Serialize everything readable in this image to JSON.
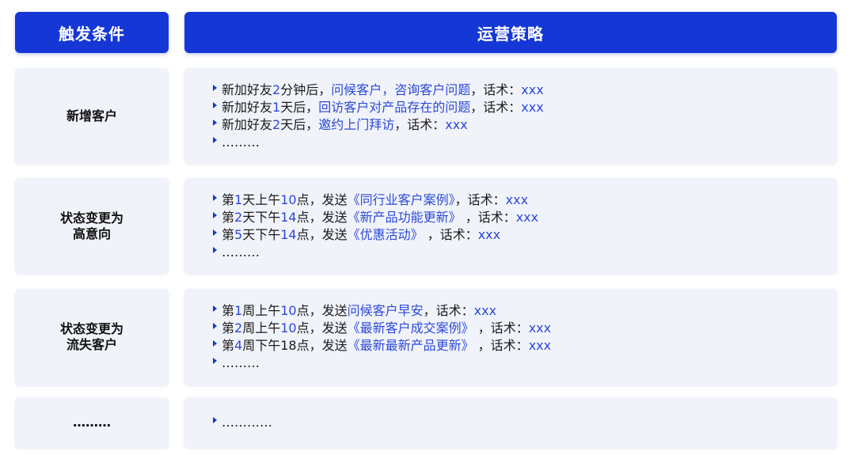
{
  "headers": {
    "trigger": "触发条件",
    "strategy": "运营策略"
  },
  "rows": [
    {
      "trigger_lines": [
        "新增客户"
      ],
      "lines": [
        {
          "a": "新加好友",
          "b": "2",
          "c": "分钟后，",
          "d": "问候客户，咨询客户问题",
          "e": "，话术：",
          "f": "xxx"
        },
        {
          "a": "新加好友",
          "b": "1",
          "c": "天后，",
          "d": "回访客户对产品存在的问题",
          "e": "，话术：",
          "f": "xxx"
        },
        {
          "a": "新加好友",
          "b": "2",
          "c": "天后，",
          "d": "邀约上门拜访",
          "e": "，话术：",
          "f": "xxx"
        },
        {
          "a": "………",
          "b": "",
          "c": "",
          "d": "",
          "e": "",
          "f": ""
        }
      ]
    },
    {
      "trigger_lines": [
        "状态变更为",
        "高意向"
      ],
      "lines": [
        {
          "a": "第",
          "b": "1",
          "c": "天上午",
          "g": "10",
          "h": "点，发送",
          "d": "《同行业客户案例》",
          "e": "，话术：",
          "f": "xxx"
        },
        {
          "a": "第",
          "b": "2",
          "c": "天下午",
          "g": "14",
          "h": "点，发送",
          "d": "《新产品功能更新》",
          "e": " ，话术：",
          "f": "xxx"
        },
        {
          "a": "第",
          "b": "5",
          "c": "天下午",
          "g": "14",
          "h": "点，发送",
          "d": "《优惠活动》",
          "e": " ，话术：",
          "f": "xxx"
        },
        {
          "a": "………",
          "b": "",
          "c": "",
          "g": "",
          "h": "",
          "d": "",
          "e": "",
          "f": ""
        }
      ]
    },
    {
      "trigger_lines": [
        "状态变更为",
        "流失客户"
      ],
      "lines": [
        {
          "a": "第",
          "b": "1",
          "c": "周上午",
          "g": "10",
          "h": "点，发送",
          "d": "问候客户早安",
          "e": "，话术：",
          "f": "xxx"
        },
        {
          "a": "第",
          "b": "2",
          "c": "周上午",
          "g": "10",
          "h": "点，发送",
          "d": "《最新客户成交案例》",
          "e": " ，话术：",
          "f": "xxx"
        },
        {
          "a": "第",
          "b": "4",
          "c": "周下午18点，发送",
          "g": "",
          "h": "",
          "d": "《最新最新产品更新》",
          "e": " ，话术：",
          "f": "xxx"
        },
        {
          "a": "………",
          "b": "",
          "c": "",
          "g": "",
          "h": "",
          "d": "",
          "e": "",
          "f": ""
        }
      ]
    },
    {
      "trigger_lines": [
        "………"
      ],
      "lines": [
        {
          "a": "…………"
        }
      ]
    }
  ]
}
